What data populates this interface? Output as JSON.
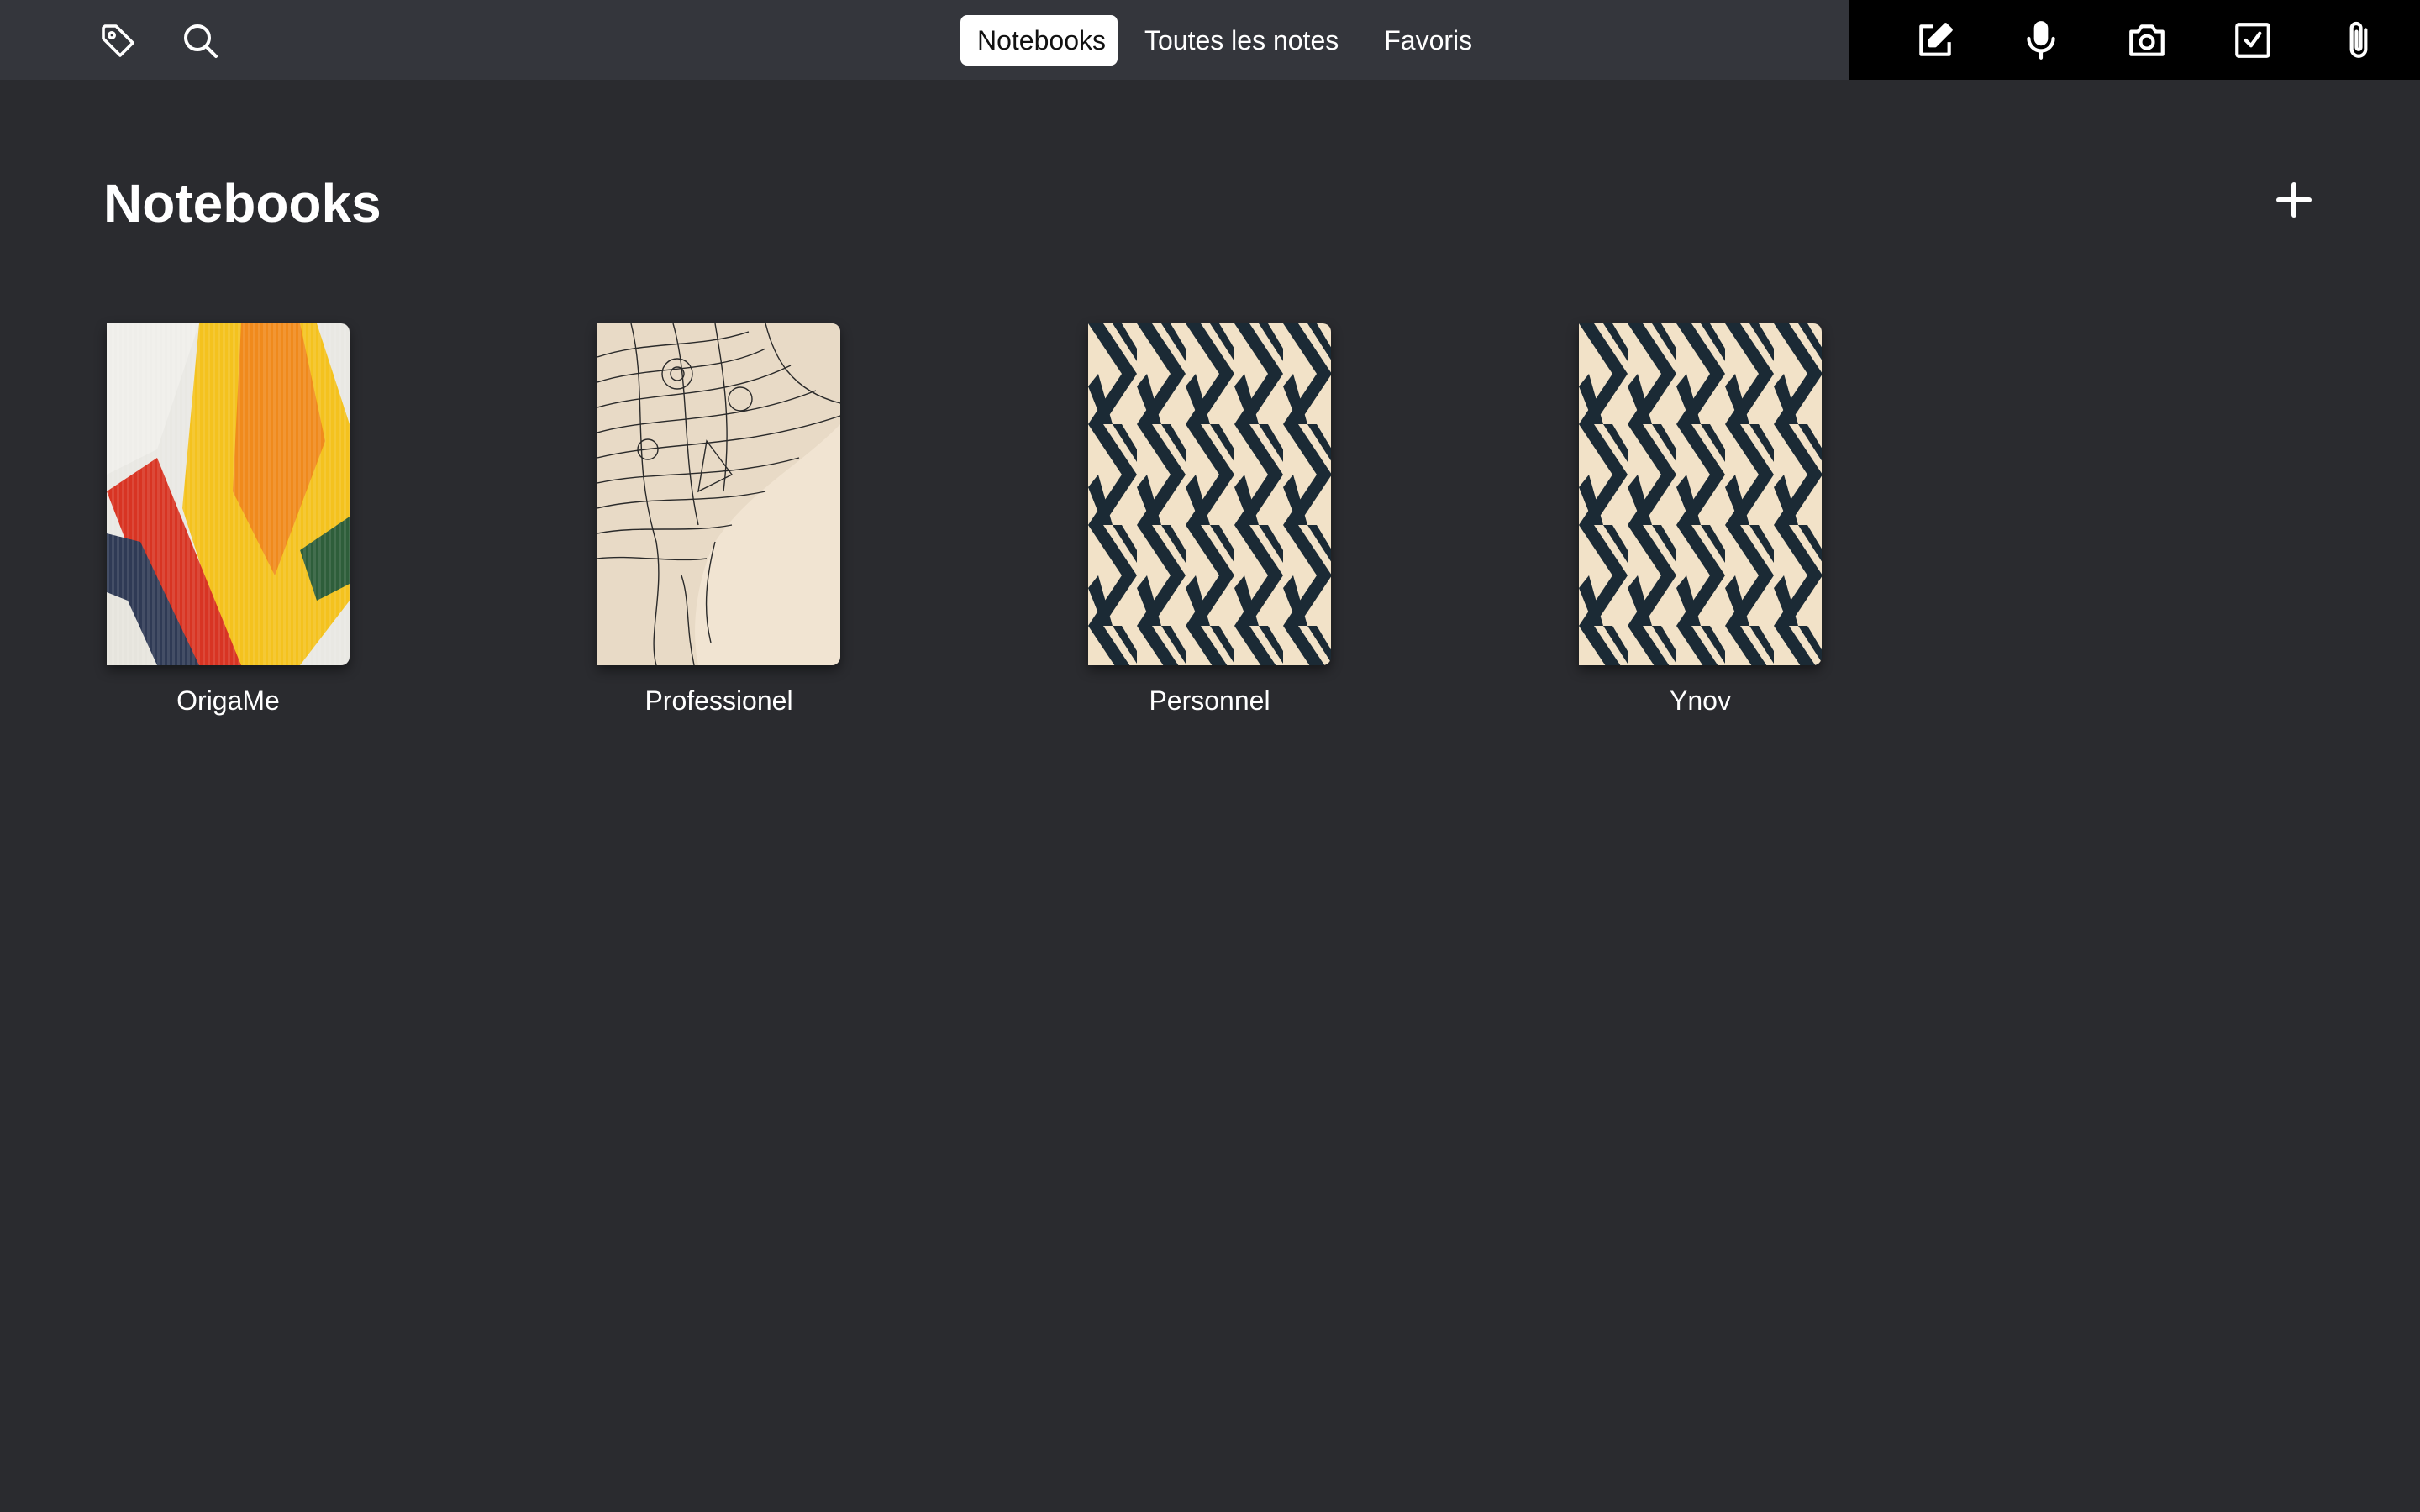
{
  "topbar": {
    "left_icons": [
      "tag-icon",
      "search-icon"
    ],
    "tabs": [
      {
        "label": "Notebooks",
        "active": true
      },
      {
        "label": "Toutes les notes",
        "active": false
      },
      {
        "label": "Favoris",
        "active": false
      }
    ],
    "right_icons": [
      "compose-icon",
      "microphone-icon",
      "camera-icon",
      "checkbox-icon",
      "paperclip-icon"
    ]
  },
  "main": {
    "title": "Notebooks",
    "add_icon": "plus-icon",
    "notebooks": [
      {
        "label": "OrigaMe",
        "cover": "abstract-paint"
      },
      {
        "label": "Professionel",
        "cover": "elephant-sketch"
      },
      {
        "label": "Personnel",
        "cover": "zigzag-pattern"
      },
      {
        "label": "Ynov",
        "cover": "zigzag-pattern"
      }
    ]
  },
  "colors": {
    "background": "#2a2b2f",
    "topbar": "#34363c",
    "right_toolbar": "#000000",
    "active_tab": "#ffffff",
    "pattern_dark": "#1b2a35",
    "pattern_light": "#f2e2c8"
  }
}
